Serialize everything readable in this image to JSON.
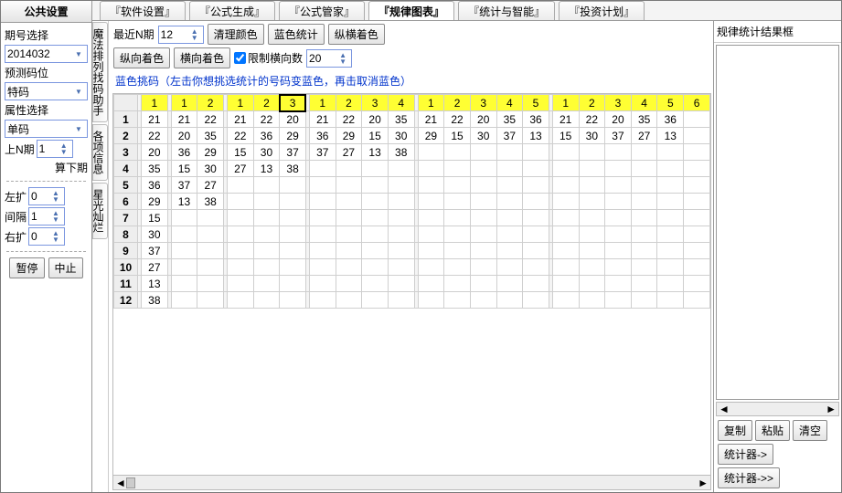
{
  "left": {
    "title": "公共设置",
    "period_label": "期号选择",
    "period_value": "2014032",
    "predict_label": "预测码位",
    "predict_value": "特码",
    "attr_label": "属性选择",
    "attr_value": "单码",
    "lastn_label": "上N期",
    "lastn_value": "1",
    "calc_next": "算下期",
    "left_ext_label": "左扩",
    "left_ext_value": "0",
    "gap_label": "间隔",
    "gap_value": "1",
    "right_ext_label": "右扩",
    "right_ext_value": "0",
    "pause": "暂停",
    "stop": "中止"
  },
  "tabs": {
    "t1": "『软件设置』",
    "t2": "『公式生成』",
    "t3": "『公式管家』",
    "t4": "『规律图表』",
    "t5": "『统计与智能』",
    "t6": "『投资计划』"
  },
  "vtabs": {
    "v1": "魔法排列找码助手",
    "v2": "各项信息",
    "v3": "星光灿烂"
  },
  "toolbar": {
    "recent_label": "最近N期",
    "recent_value": "12",
    "clear_color": "清理颜色",
    "blue_stat": "蓝色统计",
    "vh_color": "纵横着色",
    "v_color": "纵向着色",
    "h_color": "横向着色",
    "limit_h_label": "限制横向数",
    "limit_h_value": "20",
    "hint": "蓝色挑码（左击你想挑选统计的号码变蓝色，再击取消蓝色）"
  },
  "chart_data": {
    "type": "table",
    "header_groups": [
      [
        "1"
      ],
      [
        "1",
        "2"
      ],
      [
        "1",
        "2",
        "3"
      ],
      [
        "1",
        "2",
        "3",
        "4"
      ],
      [
        "1",
        "2",
        "3",
        "4",
        "5"
      ],
      [
        "1",
        "2",
        "3",
        "4",
        "5",
        "6"
      ]
    ],
    "selected_header": {
      "group": 2,
      "index": 2
    },
    "rows": [
      {
        "idx": "1",
        "cells": [
          [
            "21"
          ],
          [
            "21",
            "22"
          ],
          [
            "21",
            "22",
            "20"
          ],
          [
            "21",
            "22",
            "20",
            "35"
          ],
          [
            "21",
            "22",
            "20",
            "35",
            "36"
          ],
          [
            "21",
            "22",
            "20",
            "35",
            "36",
            ""
          ]
        ]
      },
      {
        "idx": "2",
        "cells": [
          [
            "22"
          ],
          [
            "20",
            "35"
          ],
          [
            "22",
            "36",
            "29"
          ],
          [
            "36",
            "29",
            "15",
            "30"
          ],
          [
            "29",
            "15",
            "30",
            "37",
            "13"
          ],
          [
            "15",
            "30",
            "37",
            "27",
            "13",
            ""
          ]
        ]
      },
      {
        "idx": "3",
        "cells": [
          [
            "20"
          ],
          [
            "36",
            "29"
          ],
          [
            "15",
            "30",
            "37"
          ],
          [
            "37",
            "27",
            "13",
            "38"
          ],
          [
            "",
            "",
            "",
            "",
            ""
          ],
          [
            "",
            "",
            "",
            "",
            "",
            ""
          ]
        ]
      },
      {
        "idx": "4",
        "cells": [
          [
            "35"
          ],
          [
            "15",
            "30"
          ],
          [
            "27",
            "13",
            "38"
          ],
          [
            "",
            "",
            "",
            ""
          ],
          [
            "",
            "",
            "",
            "",
            ""
          ],
          [
            "",
            "",
            "",
            "",
            "",
            ""
          ]
        ]
      },
      {
        "idx": "5",
        "cells": [
          [
            "36"
          ],
          [
            "37",
            "27"
          ],
          [
            "",
            "",
            ""
          ],
          [
            "",
            "",
            "",
            ""
          ],
          [
            "",
            "",
            "",
            "",
            ""
          ],
          [
            "",
            "",
            "",
            "",
            "",
            ""
          ]
        ]
      },
      {
        "idx": "6",
        "cells": [
          [
            "29"
          ],
          [
            "13",
            "38"
          ],
          [
            "",
            "",
            ""
          ],
          [
            "",
            "",
            "",
            ""
          ],
          [
            "",
            "",
            "",
            "",
            ""
          ],
          [
            "",
            "",
            "",
            "",
            "",
            ""
          ]
        ]
      },
      {
        "idx": "7",
        "cells": [
          [
            "15"
          ],
          [
            "",
            ""
          ],
          [
            "",
            "",
            ""
          ],
          [
            "",
            "",
            "",
            ""
          ],
          [
            "",
            "",
            "",
            "",
            ""
          ],
          [
            "",
            "",
            "",
            "",
            "",
            ""
          ]
        ]
      },
      {
        "idx": "8",
        "cells": [
          [
            "30"
          ],
          [
            "",
            ""
          ],
          [
            "",
            "",
            ""
          ],
          [
            "",
            "",
            "",
            ""
          ],
          [
            "",
            "",
            "",
            "",
            ""
          ],
          [
            "",
            "",
            "",
            "",
            "",
            ""
          ]
        ]
      },
      {
        "idx": "9",
        "cells": [
          [
            "37"
          ],
          [
            "",
            ""
          ],
          [
            "",
            "",
            ""
          ],
          [
            "",
            "",
            "",
            ""
          ],
          [
            "",
            "",
            "",
            "",
            ""
          ],
          [
            "",
            "",
            "",
            "",
            "",
            ""
          ]
        ]
      },
      {
        "idx": "10",
        "cells": [
          [
            "27"
          ],
          [
            "",
            ""
          ],
          [
            "",
            "",
            ""
          ],
          [
            "",
            "",
            "",
            ""
          ],
          [
            "",
            "",
            "",
            "",
            ""
          ],
          [
            "",
            "",
            "",
            "",
            "",
            ""
          ]
        ]
      },
      {
        "idx": "11",
        "cells": [
          [
            "13"
          ],
          [
            "",
            ""
          ],
          [
            "",
            "",
            ""
          ],
          [
            "",
            "",
            "",
            ""
          ],
          [
            "",
            "",
            "",
            "",
            ""
          ],
          [
            "",
            "",
            "",
            "",
            "",
            ""
          ]
        ]
      },
      {
        "idx": "12",
        "cells": [
          [
            "38"
          ],
          [
            "",
            ""
          ],
          [
            "",
            "",
            ""
          ],
          [
            "",
            "",
            "",
            ""
          ],
          [
            "",
            "",
            "",
            "",
            ""
          ],
          [
            "",
            "",
            "",
            "",
            "",
            ""
          ]
        ]
      }
    ]
  },
  "right": {
    "title": "规律统计结果框",
    "copy": "复制",
    "paste": "粘贴",
    "clear": "清空",
    "calc_left": "统计器->",
    "calc_right": "统计器->>"
  }
}
